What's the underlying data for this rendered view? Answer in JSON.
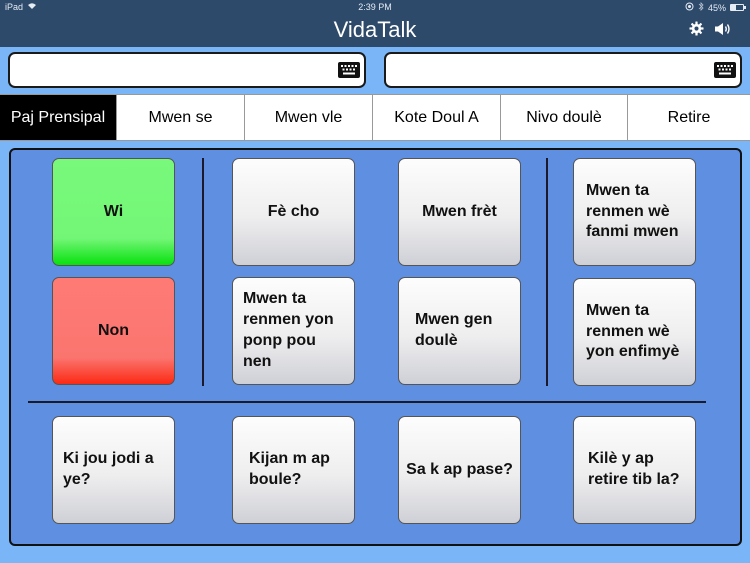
{
  "status_bar": {
    "device": "iPad",
    "time": "2:39 PM",
    "battery_percent": "45%",
    "icons": [
      "wifi-icon",
      "location-lock-icon",
      "bluetooth-icon",
      "battery-icon"
    ]
  },
  "header": {
    "title": "VidaTalk",
    "icons": [
      "gear-icon",
      "speaker-icon"
    ]
  },
  "inputs": [
    {
      "value": "",
      "placeholder": "",
      "icon": "keyboard-icon"
    },
    {
      "value": "",
      "placeholder": "",
      "icon": "keyboard-icon"
    }
  ],
  "tabs": [
    {
      "label": "Paj Prensipal",
      "active": true
    },
    {
      "label": "Mwen se",
      "active": false
    },
    {
      "label": "Mwen vle",
      "active": false
    },
    {
      "label": "Kote Doul A",
      "active": false
    },
    {
      "label": "Nivo doulè",
      "active": false
    },
    {
      "label": "Retire",
      "active": false
    }
  ],
  "cards": {
    "yes": "Wi",
    "no": "Non",
    "very_hot": "Fè cho",
    "cold": "Mwen frèt",
    "family": "Mwen ta renmen wè fanmi mwen",
    "bedpan": "Mwen ta renmen yon ponp pou nen",
    "pain": "Mwen gen doulè",
    "nurse": "Mwen ta renmen wè yon enfimyè",
    "what_day": "Ki jou jodi a ye?",
    "how_am_i": "Kijan m ap boule?",
    "what_happening": "Sa k ap pase?",
    "when_tube": "Kilè y ap retire tib la?"
  },
  "colors": {
    "header_bg": "#2e4a6a",
    "page_bg": "#7ab6f7",
    "panel_bg": "#5f8fe0",
    "yes_green": "#73f676",
    "no_red": "#fb756f",
    "active_tab": "#000000"
  }
}
